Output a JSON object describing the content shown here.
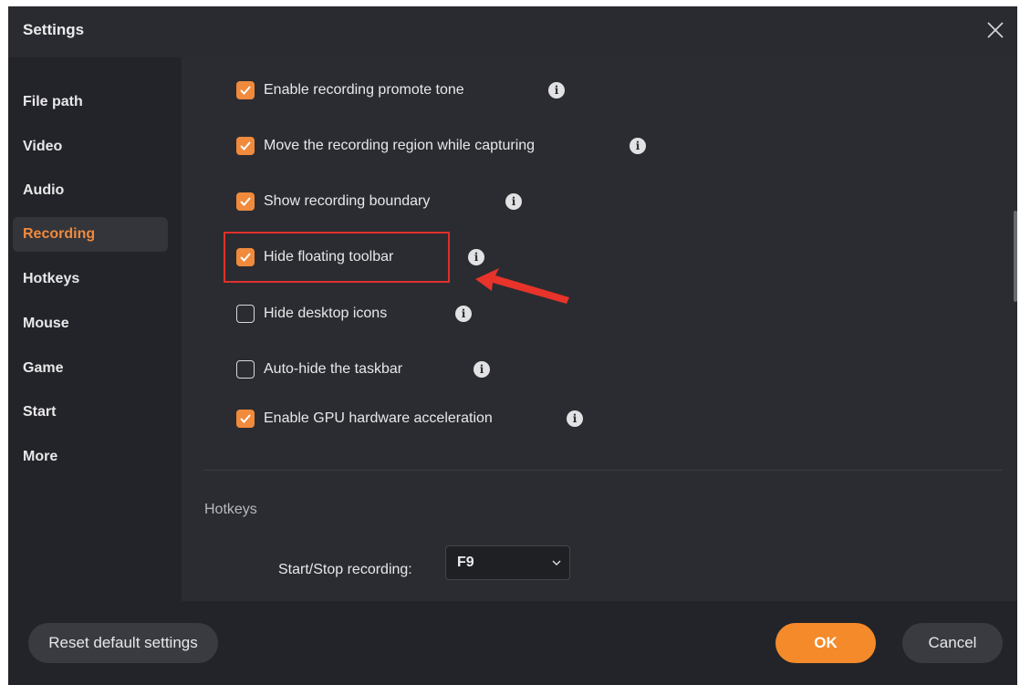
{
  "window": {
    "title": "Settings"
  },
  "sidebar": {
    "items": [
      {
        "label": "File path"
      },
      {
        "label": "Video"
      },
      {
        "label": "Audio"
      },
      {
        "label": "Recording",
        "active": true
      },
      {
        "label": "Hotkeys"
      },
      {
        "label": "Mouse"
      },
      {
        "label": "Game"
      },
      {
        "label": "Start"
      },
      {
        "label": "More"
      }
    ]
  },
  "options": [
    {
      "label": "Enable recording promote tone",
      "checked": true
    },
    {
      "label": "Move the recording region while capturing",
      "checked": true
    },
    {
      "label": "Show recording boundary",
      "checked": true
    },
    {
      "label": "Hide floating toolbar",
      "checked": true,
      "highlighted": true
    },
    {
      "label": "Hide desktop icons",
      "checked": false
    },
    {
      "label": "Auto-hide the taskbar",
      "checked": false
    },
    {
      "label": "Enable GPU hardware acceleration",
      "checked": true
    }
  ],
  "hotkeys": {
    "section_title": "Hotkeys",
    "start_stop_label": "Start/Stop recording:",
    "start_stop_value": "F9"
  },
  "footer": {
    "reset_label": "Reset default settings",
    "ok_label": "OK",
    "cancel_label": "Cancel"
  },
  "icons": {
    "info": "info-icon",
    "check": "check-icon",
    "close": "close-icon",
    "chevron": "chevron-down-icon",
    "annotation_arrow": "red-arrow-annotation"
  },
  "colors": {
    "accent": "#f08a3c",
    "ok_button": "#f58a2a",
    "highlight_box": "#e0302a",
    "background": "#232429",
    "panel": "#2b2c31"
  }
}
